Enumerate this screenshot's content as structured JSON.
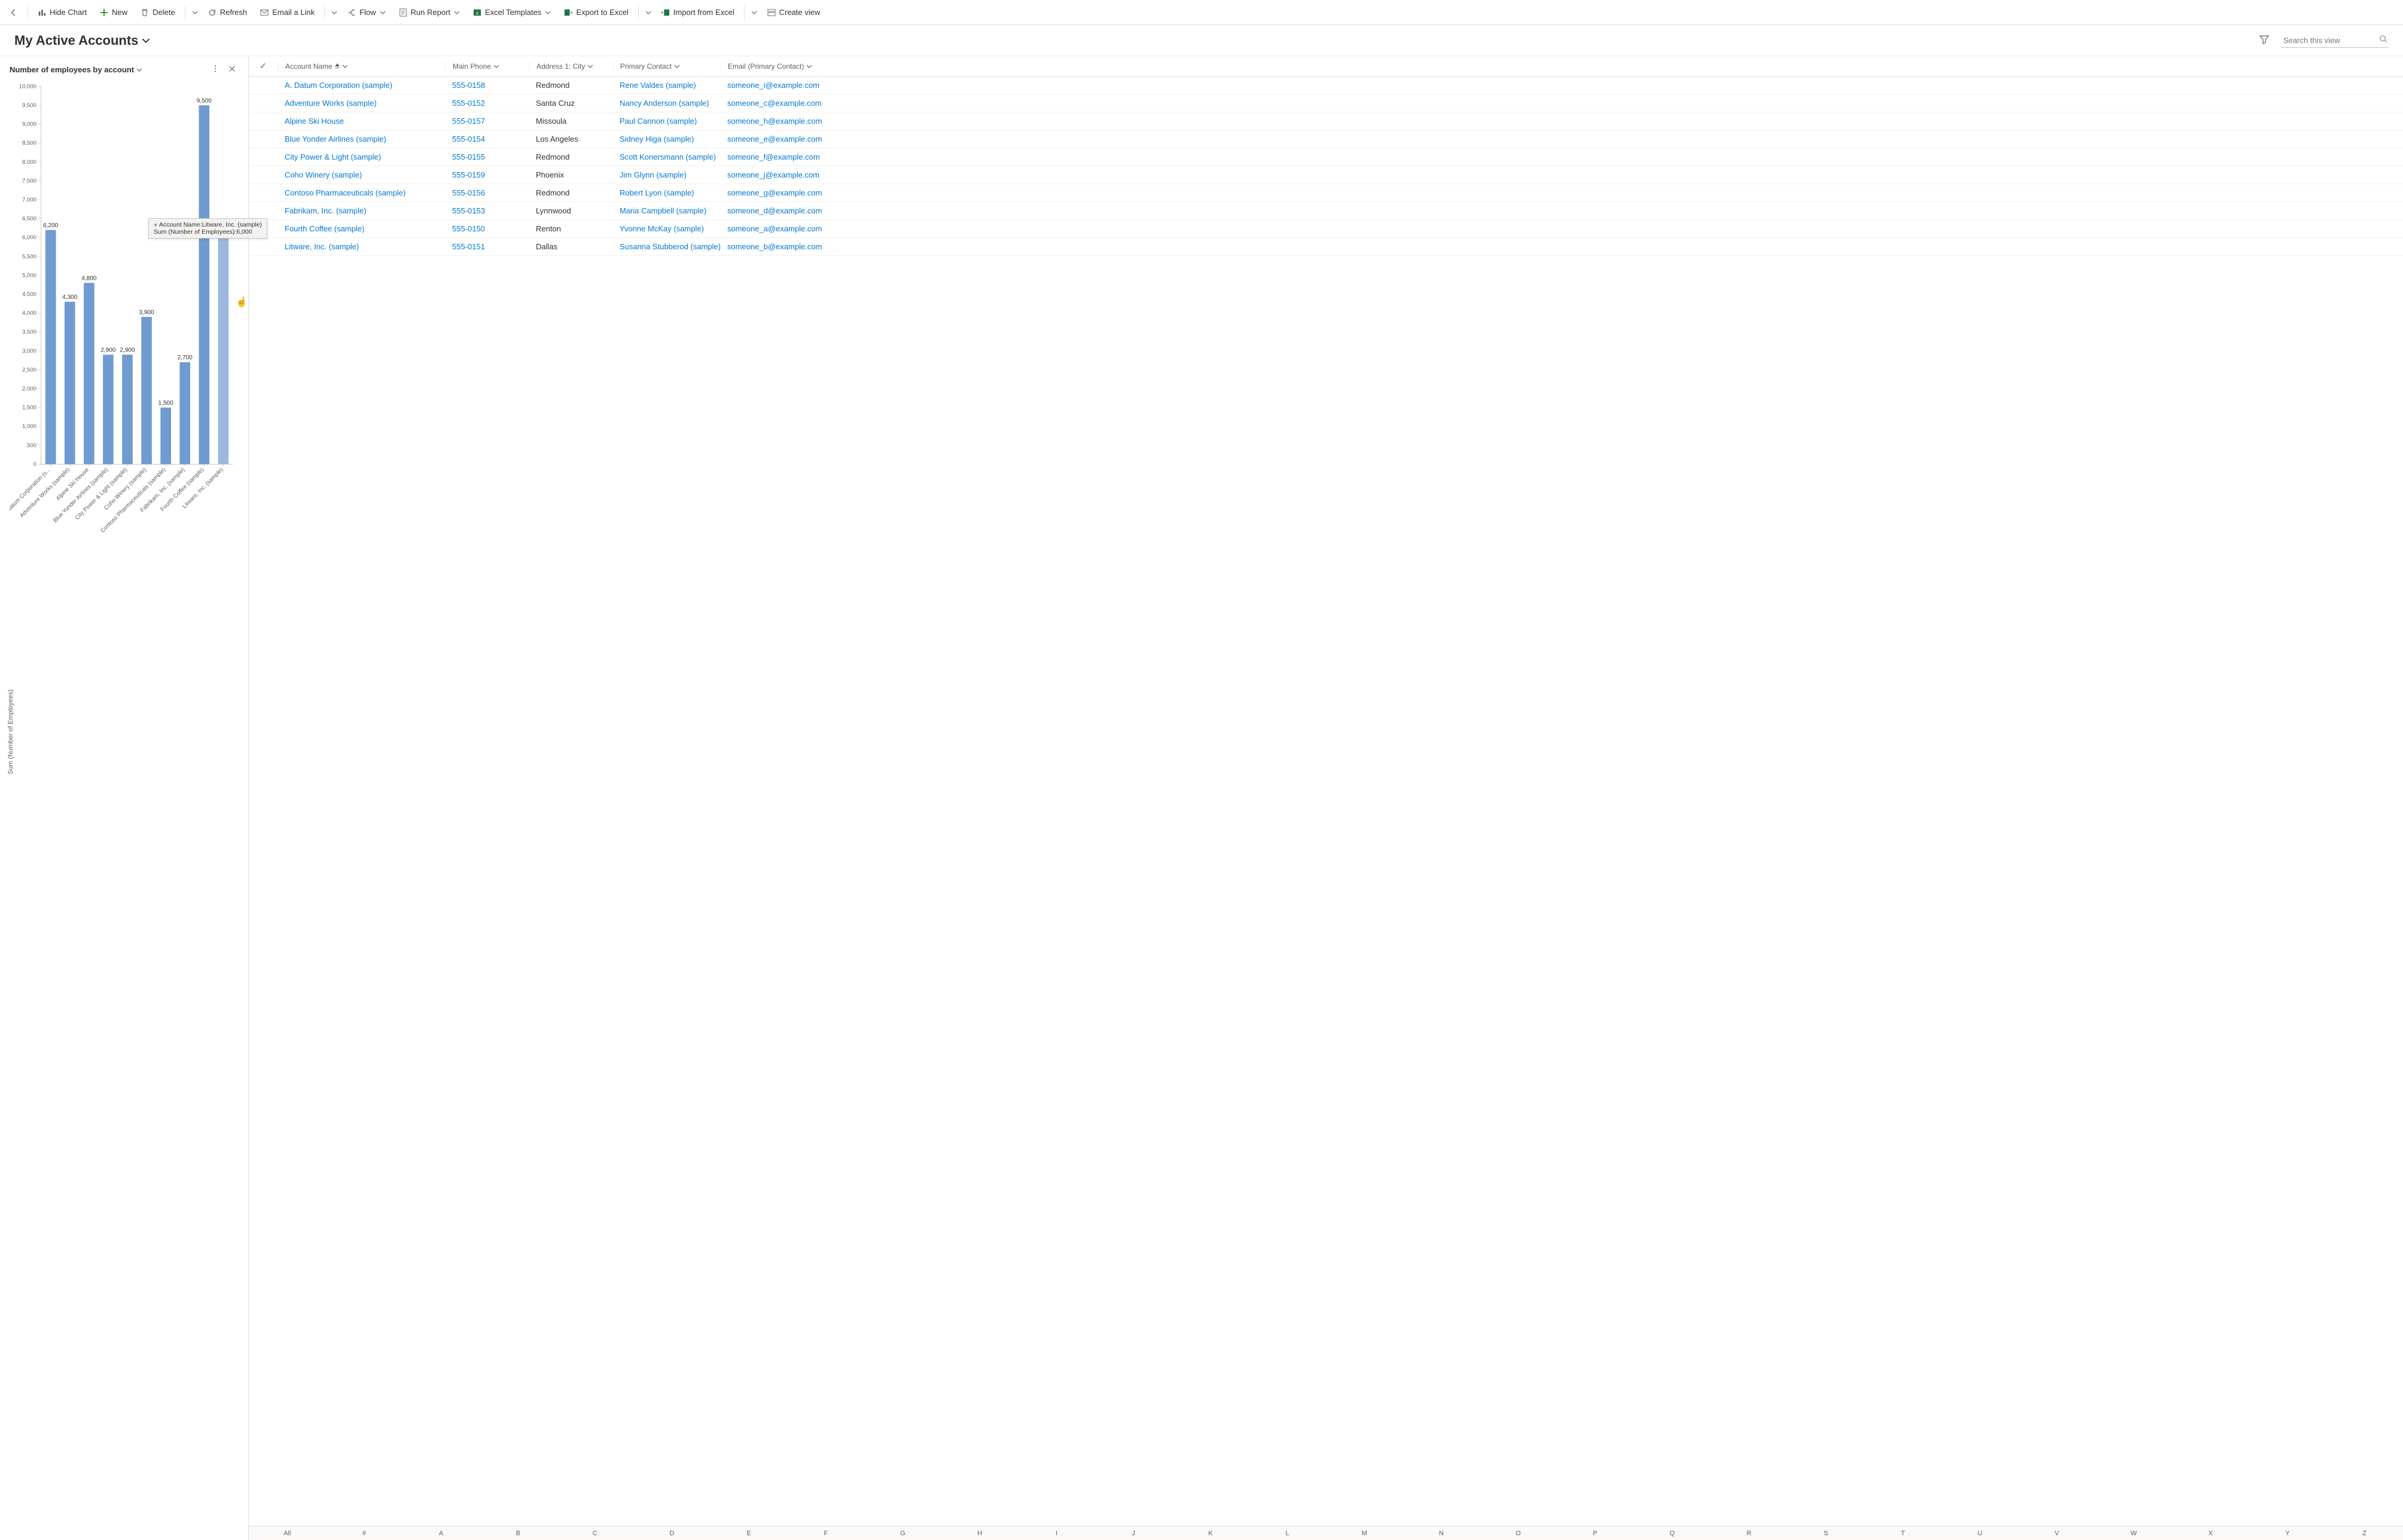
{
  "toolbar": {
    "back": "←",
    "hide_chart": "Hide Chart",
    "new": "New",
    "delete": "Delete",
    "refresh": "Refresh",
    "email_link": "Email a Link",
    "flow": "Flow",
    "run_report": "Run Report",
    "excel_templates": "Excel Templates",
    "export_excel": "Export to Excel",
    "import_excel": "Import from Excel",
    "create_view": "Create view"
  },
  "view": {
    "title": "My Active Accounts",
    "search_placeholder": "Search this view"
  },
  "chart_pane": {
    "title": "Number of employees by account"
  },
  "chart_data": {
    "type": "bar",
    "ylabel": "Sum (Number of Employees)",
    "ylim": [
      0,
      10000
    ],
    "ytick_step": 500,
    "categories": [
      "A. Datum Corporation (s...",
      "Adventure Works (sample)",
      "Alpine Ski House",
      "Blue Yonder Airlines (sample)",
      "City Power & Light (sample)",
      "Coho Winery (sample)",
      "Contoso Pharmaceuticals (sample)",
      "Fabrikam, Inc. (sample)",
      "Fourth Coffee (sample)",
      "Litware, Inc. (sample)"
    ],
    "values": [
      6200,
      4300,
      4800,
      2900,
      2900,
      3900,
      1500,
      2700,
      9500,
      6000
    ],
    "tooltip": {
      "line1": "Account Name:Litware, Inc. (sample)",
      "line2": "Sum (Number of Employees):6,000"
    }
  },
  "grid": {
    "columns": {
      "name": "Account Name",
      "phone": "Main Phone",
      "city": "Address 1: City",
      "contact": "Primary Contact",
      "email": "Email (Primary Contact)"
    },
    "rows": [
      {
        "name": "A. Datum Corporation (sample)",
        "phone": "555-0158",
        "city": "Redmond",
        "contact": "Rene Valdes (sample)",
        "email": "someone_i@example.com"
      },
      {
        "name": "Adventure Works (sample)",
        "phone": "555-0152",
        "city": "Santa Cruz",
        "contact": "Nancy Anderson (sample)",
        "email": "someone_c@example.com"
      },
      {
        "name": "Alpine Ski House",
        "phone": "555-0157",
        "city": "Missoula",
        "contact": "Paul Cannon (sample)",
        "email": "someone_h@example.com"
      },
      {
        "name": "Blue Yonder Airlines (sample)",
        "phone": "555-0154",
        "city": "Los Angeles",
        "contact": "Sidney Higa (sample)",
        "email": "someone_e@example.com"
      },
      {
        "name": "City Power & Light (sample)",
        "phone": "555-0155",
        "city": "Redmond",
        "contact": "Scott Konersmann (sample)",
        "email": "someone_f@example.com"
      },
      {
        "name": "Coho Winery (sample)",
        "phone": "555-0159",
        "city": "Phoenix",
        "contact": "Jim Glynn (sample)",
        "email": "someone_j@example.com"
      },
      {
        "name": "Contoso Pharmaceuticals (sample)",
        "phone": "555-0156",
        "city": "Redmond",
        "contact": "Robert Lyon (sample)",
        "email": "someone_g@example.com"
      },
      {
        "name": "Fabrikam, Inc. (sample)",
        "phone": "555-0153",
        "city": "Lynnwood",
        "contact": "Maria Campbell (sample)",
        "email": "someone_d@example.com"
      },
      {
        "name": "Fourth Coffee (sample)",
        "phone": "555-0150",
        "city": "Renton",
        "contact": "Yvonne McKay (sample)",
        "email": "someone_a@example.com"
      },
      {
        "name": "Litware, Inc. (sample)",
        "phone": "555-0151",
        "city": "Dallas",
        "contact": "Susanna Stubberod (sample)",
        "email": "someone_b@example.com"
      }
    ]
  },
  "alpha": [
    "All",
    "#",
    "A",
    "B",
    "C",
    "D",
    "E",
    "F",
    "G",
    "H",
    "I",
    "J",
    "K",
    "L",
    "M",
    "N",
    "O",
    "P",
    "Q",
    "R",
    "S",
    "T",
    "U",
    "V",
    "W",
    "X",
    "Y",
    "Z"
  ]
}
